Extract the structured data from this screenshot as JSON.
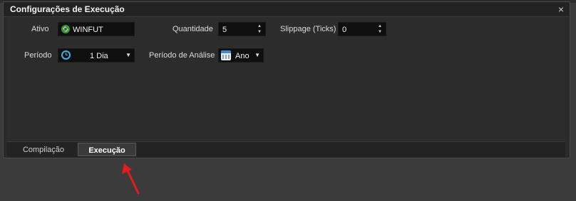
{
  "window": {
    "title": "Configurações de Execução",
    "close_glyph": "×"
  },
  "fields": {
    "ativo": {
      "label": "Ativo",
      "value": "WINFUT",
      "icon": "brazil-flag-icon"
    },
    "quantidade": {
      "label": "Quantidade",
      "value": "5"
    },
    "slippage": {
      "label": "Slippage (Ticks)",
      "value": "0"
    },
    "periodo": {
      "label": "Período",
      "value": "1 Dia",
      "icon": "clock-icon"
    },
    "periodo_analise": {
      "label": "Período de Análise",
      "value": "Ano",
      "icon": "calendar-icon"
    }
  },
  "tabs": [
    {
      "label": "Compilação",
      "active": false
    },
    {
      "label": "Execução",
      "active": true
    }
  ],
  "colors": {
    "background": "#3b3b3b",
    "panel": "#2a2a2a",
    "field": "#0f0f0f",
    "accent_arrow": "#e21b1b",
    "clock": "#3bb3e8"
  }
}
